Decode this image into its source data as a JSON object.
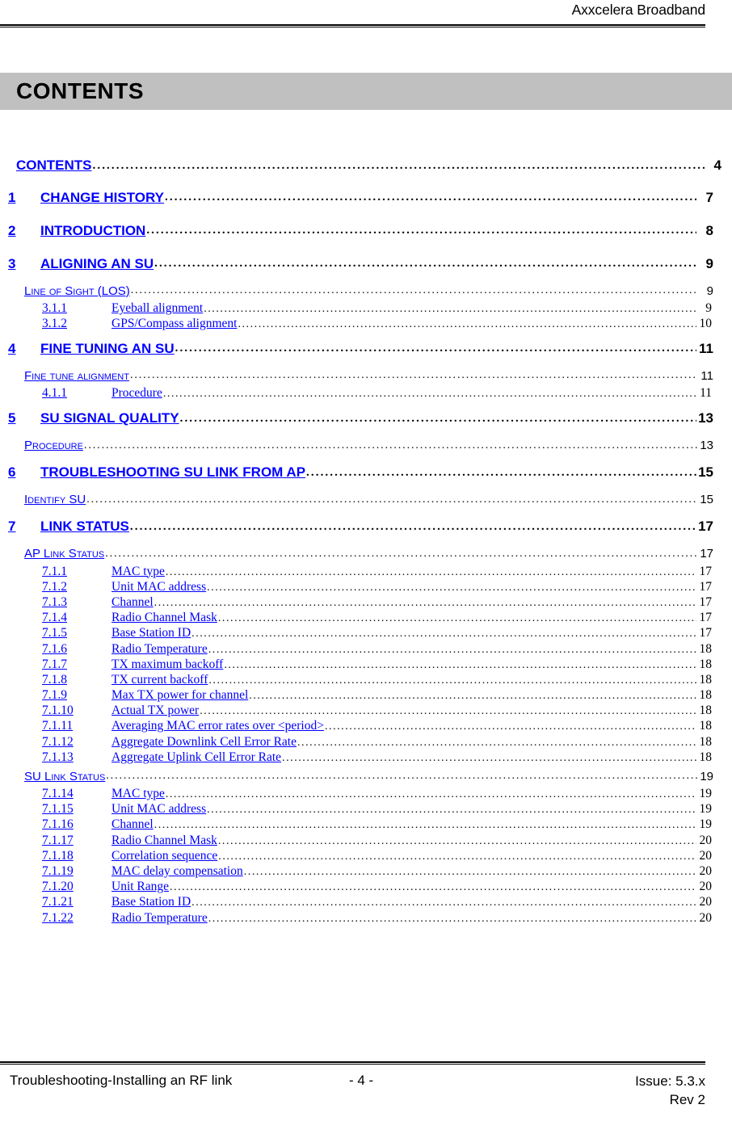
{
  "header": {
    "company": "Axxcelera Broadband"
  },
  "banner": {
    "title": "CONTENTS"
  },
  "toc": {
    "entries": [
      {
        "level": 0,
        "num": "",
        "label": "CONTENTS",
        "page": "4"
      },
      {
        "level": 1,
        "num": "1",
        "label": "CHANGE HISTORY",
        "page": "7"
      },
      {
        "level": 1,
        "num": "2",
        "label": "INTRODUCTION",
        "page": "8"
      },
      {
        "level": 1,
        "num": "3",
        "label": "ALIGNING AN SU",
        "page": "9"
      },
      {
        "level": 2,
        "num": "",
        "label": "Line of Sight (LOS)",
        "page": "9"
      },
      {
        "level": 3,
        "num": "3.1.1",
        "label": "Eyeball alignment",
        "page": "9"
      },
      {
        "level": 3,
        "num": "3.1.2",
        "label": "GPS/Compass alignment",
        "page": "10"
      },
      {
        "level": 1,
        "num": "4",
        "label": "FINE TUNING AN SU",
        "page": "11"
      },
      {
        "level": 2,
        "num": "",
        "label": "Fine tune alignment",
        "page": "11"
      },
      {
        "level": 3,
        "num": "4.1.1",
        "label": "Procedure",
        "page": "11"
      },
      {
        "level": 1,
        "num": "5",
        "label": "SU SIGNAL QUALITY",
        "page": "13"
      },
      {
        "level": 2,
        "num": "",
        "label": "Procedure",
        "page": "13"
      },
      {
        "level": 1,
        "num": "6",
        "label": "TROUBLESHOOTING SU LINK FROM AP",
        "page": "15"
      },
      {
        "level": 2,
        "num": "",
        "label": "Identify SU",
        "page": "15"
      },
      {
        "level": 1,
        "num": "7",
        "label": "LINK STATUS",
        "page": "17"
      },
      {
        "level": 2,
        "num": "",
        "label": "AP Link Status",
        "page": "17"
      },
      {
        "level": 3,
        "num": "7.1.1",
        "label": "MAC type",
        "page": "17"
      },
      {
        "level": 3,
        "num": "7.1.2",
        "label": "Unit MAC address",
        "page": "17"
      },
      {
        "level": 3,
        "num": "7.1.3",
        "label": "Channel",
        "page": "17"
      },
      {
        "level": 3,
        "num": "7.1.4",
        "label": "Radio Channel Mask",
        "page": "17"
      },
      {
        "level": 3,
        "num": "7.1.5",
        "label": "Base Station ID",
        "page": "17"
      },
      {
        "level": 3,
        "num": "7.1.6",
        "label": "Radio Temperature",
        "page": "18"
      },
      {
        "level": 3,
        "num": "7.1.7",
        "label": "TX maximum backoff",
        "page": "18"
      },
      {
        "level": 3,
        "num": "7.1.8",
        "label": "TX current backoff",
        "page": "18"
      },
      {
        "level": 3,
        "num": "7.1.9",
        "label": "Max TX  power for channel",
        "page": "18"
      },
      {
        "level": 3,
        "num": "7.1.10",
        "label": "Actual TX power",
        "page": "18"
      },
      {
        "level": 3,
        "num": "7.1.11",
        "label": "Averaging MAC error rates over <period>",
        "page": "18"
      },
      {
        "level": 3,
        "num": "7.1.12",
        "label": "Aggregate Downlink Cell Error Rate",
        "page": "18"
      },
      {
        "level": 3,
        "num": "7.1.13",
        "label": "Aggregate Uplink Cell Error Rate",
        "page": "18"
      },
      {
        "level": 2,
        "num": "",
        "label": "SU Link Status",
        "page": "19"
      },
      {
        "level": 3,
        "num": "7.1.14",
        "label": "MAC type",
        "page": "19"
      },
      {
        "level": 3,
        "num": "7.1.15",
        "label": "Unit MAC address",
        "page": "19"
      },
      {
        "level": 3,
        "num": "7.1.16",
        "label": "Channel",
        "page": "19"
      },
      {
        "level": 3,
        "num": "7.1.17",
        "label": "Radio Channel Mask",
        "page": "20"
      },
      {
        "level": 3,
        "num": "7.1.18",
        "label": "Correlation sequence",
        "page": "20"
      },
      {
        "level": 3,
        "num": "7.1.19",
        "label": "MAC delay compensation",
        "page": "20"
      },
      {
        "level": 3,
        "num": "7.1.20",
        "label": "Unit Range",
        "page": "20"
      },
      {
        "level": 3,
        "num": "7.1.21",
        "label": "Base Station ID",
        "page": "20"
      },
      {
        "level": 3,
        "num": "7.1.22",
        "label": "Radio Temperature",
        "page": "20"
      }
    ]
  },
  "footer": {
    "left": "Troubleshooting-Installing an RF link",
    "page_marker": "- 4 -",
    "issue": "Issue: 5.3.x",
    "revision": "Rev 2"
  },
  "colors": {
    "link": "#0000ff",
    "banner_background": "#c0c0c0",
    "text": "#000000"
  }
}
